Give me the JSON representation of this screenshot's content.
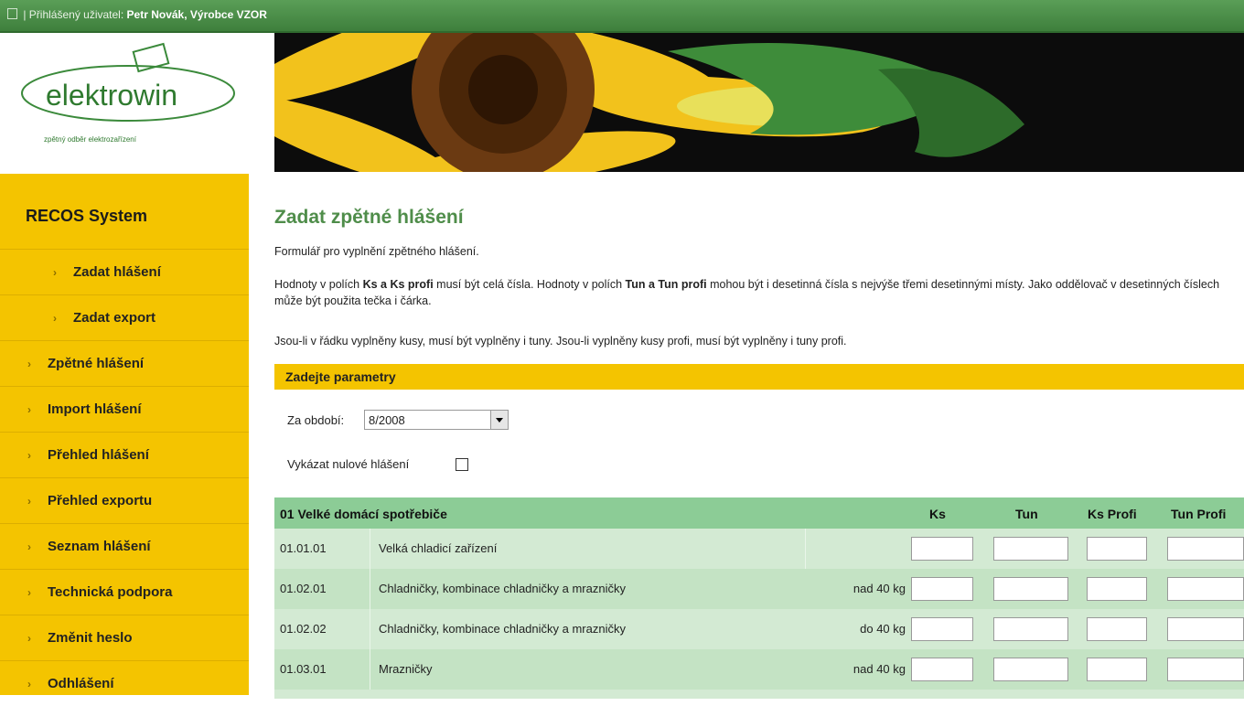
{
  "topbar": {
    "prefix": "| Přihlášený uživatel:",
    "user": "Petr Novák, Výrobce VZOR"
  },
  "logo": {
    "name": "elektrowin",
    "tagline": "zpětný odběr elektrozařízení"
  },
  "sidebar": {
    "title": "RECOS System",
    "items": [
      {
        "label": "Zadat hlášení",
        "sub": true
      },
      {
        "label": "Zadat export",
        "sub": true
      },
      {
        "label": "Zpětné hlášení",
        "sub": false
      },
      {
        "label": "Import hlášení",
        "sub": false
      },
      {
        "label": "Přehled hlášení",
        "sub": false
      },
      {
        "label": "Přehled exportu",
        "sub": false
      },
      {
        "label": "Seznam hlášení",
        "sub": false
      },
      {
        "label": "Technická podpora",
        "sub": false
      },
      {
        "label": "Změnit heslo",
        "sub": false
      },
      {
        "label": "Odhlášení",
        "sub": false
      }
    ]
  },
  "main": {
    "title": "Zadat zpětné hlášení",
    "intro": "Formulář pro vyplnění zpětného hlášení.",
    "hint1": {
      "a": "Hodnoty v polích ",
      "b": "Ks a Ks profi",
      "c": " musí být celá čísla. Hodnoty v polích ",
      "d": "Tun a Tun profi",
      "e": " mohou být i desetinná čísla s nejvýše třemi desetinnými místy. Jako oddělovač v desetinných číslech může být použita tečka i čárka."
    },
    "hint2": "Jsou-li v řádku vyplněny kusy, musí být vyplněny i tuny. Jsou-li vyplněny kusy profi, musí být vyplněny i tuny profi.",
    "section": "Zadejte parametry",
    "period_label": "Za období:",
    "period_value": "8/2008",
    "zero_label": "Vykázat nulové hlášení"
  },
  "table": {
    "category": "01 Velké domácí spotřebiče",
    "headers": {
      "ks": "Ks",
      "tun": "Tun",
      "ks_profi": "Ks Profi",
      "tun_profi": "Tun Profi"
    },
    "rows": [
      {
        "code": "01.01.01",
        "name": "Velká chladicí zařízení",
        "weight": ""
      },
      {
        "code": "01.02.01",
        "name": "Chladničky, kombinace chladničky a mrazničky",
        "weight": "nad 40 kg"
      },
      {
        "code": "01.02.02",
        "name": "Chladničky, kombinace chladničky a mrazničky",
        "weight": "do 40 kg"
      },
      {
        "code": "01.03.01",
        "name": "Mrazničky",
        "weight": "nad 40 kg"
      }
    ]
  }
}
